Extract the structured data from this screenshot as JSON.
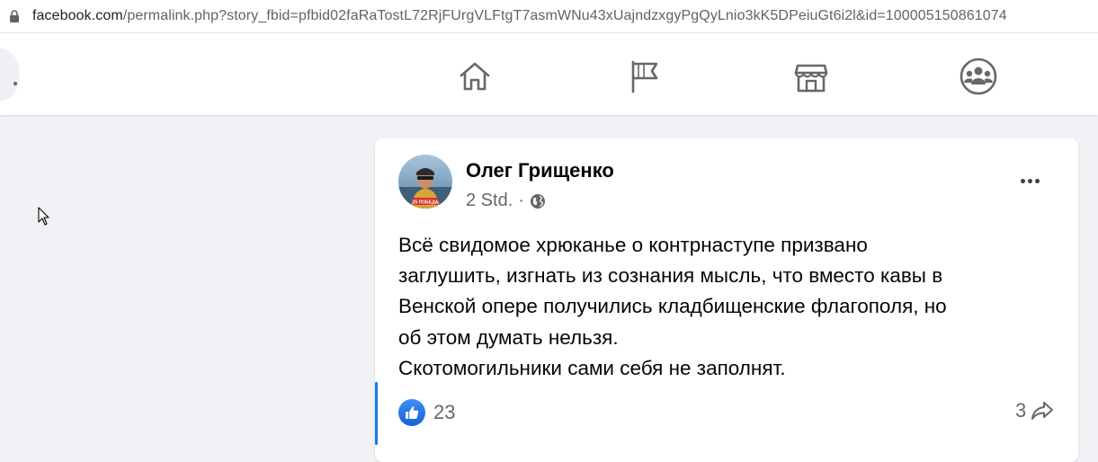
{
  "browser": {
    "url_domain": "facebook.com",
    "url_rest": "/permalink.php?story_fbid=pfbid02faRaTostL72RjFUrgVLFtgT7asmWNu43xUajndzxgyPgQyLnio3kK5DPeiuGt6i2l&id=100005150861074"
  },
  "nav": {
    "icons": [
      "home-icon",
      "pages-flag-icon",
      "marketplace-store-icon",
      "groups-icon"
    ]
  },
  "post": {
    "author": "Олег Грищенко",
    "time": "2 Std.",
    "separator": "·",
    "text": "Всё свидомое хрюканье о контрнаступе призвано\nзаглушить, изгнать из сознания мысль, что вместо кавы в\nВенской опере получились кладбищенские флагополя, но\nоб этом думать нельзя.\nСкотомогильники сами себя не заполнят.",
    "reaction_count": "23",
    "share_count": "3",
    "avatar_badge_text": "25 ПОБЕДА"
  },
  "colors": {
    "accent": "#1877f2",
    "page_bg": "#f0f2f5",
    "secondary_text": "#65676b"
  }
}
